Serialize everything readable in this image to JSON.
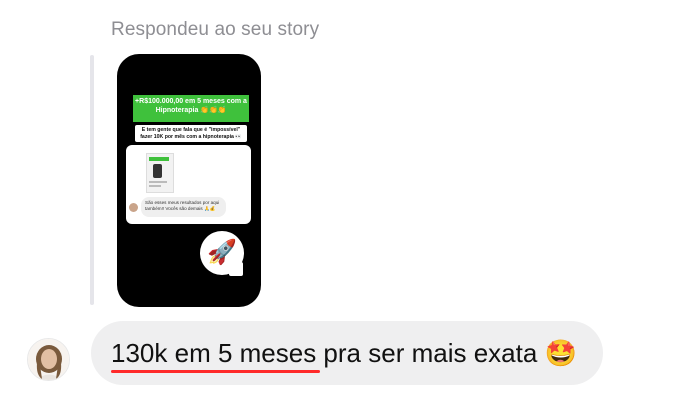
{
  "reply": {
    "caption": "Respondeu ao seu story"
  },
  "story": {
    "headline": "+R$100.000,00 em 5 meses com a Hipnoterapia 👏👏👏",
    "subheadline": "E tem gente que fala que é \"impossível\" fazer 10K por mês com a hipnoterapia 👀",
    "inner_comment": "São esses meus resultados por aqui também!! Vocês são demais 🙏💰",
    "reaction_emoji": "🚀"
  },
  "message": {
    "text": "130k em 5 meses pra ser mais exata 🤩",
    "underline_color": "#ff2a2a"
  },
  "colors": {
    "bubble_bg": "#efeff0",
    "caption": "#8e8e93",
    "story_bg": "#000000",
    "headline_green": "#3fc13c"
  }
}
